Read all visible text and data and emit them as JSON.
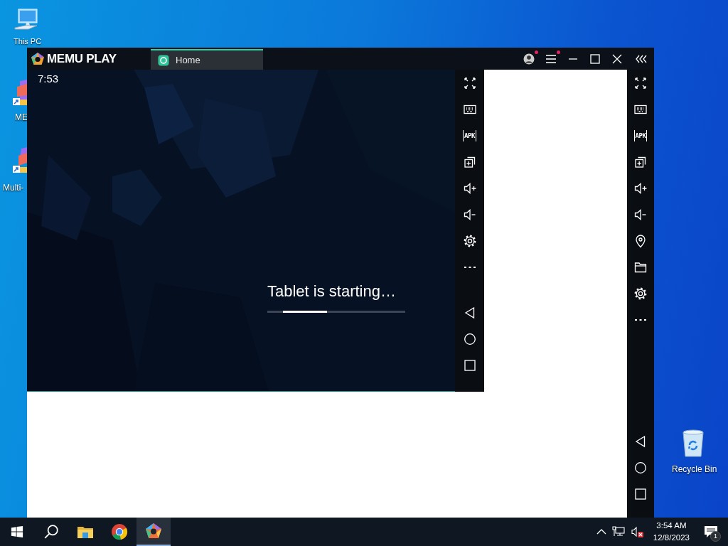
{
  "desktop_icons": [
    {
      "kind": "pc",
      "label": "This PC"
    },
    {
      "kind": "memu",
      "label": "ME"
    },
    {
      "kind": "multi",
      "label": "Multi-"
    },
    {
      "kind": "bin",
      "label": "Recycle Bin"
    }
  ],
  "emulator": {
    "logo": "MEMU PLAY",
    "tabs": [
      {
        "label": "Home",
        "selected": true
      }
    ],
    "title_buttons": [
      {
        "kind": "profile",
        "dot": true
      },
      {
        "kind": "menu",
        "dot": true
      },
      {
        "kind": "minimize",
        "dot": false
      },
      {
        "kind": "maximize",
        "dot": false
      },
      {
        "kind": "close",
        "dot": false
      },
      {
        "kind": "collapse",
        "dot": false
      }
    ],
    "screen": {
      "clock": "7:53",
      "status": "Tablet is starting…",
      "progress": {
        "level": 0.32
      }
    },
    "inner_toolbar": [
      {
        "kind": "fullscreen"
      },
      {
        "kind": "keyboard"
      },
      {
        "kind": "apk",
        "label": "APK"
      },
      {
        "kind": "multi"
      },
      {
        "kind": "volume_up"
      },
      {
        "kind": "volume_down"
      },
      {
        "kind": "settings"
      },
      {
        "kind": "more"
      }
    ],
    "inner_nav": [
      {
        "kind": "back"
      },
      {
        "kind": "home"
      },
      {
        "kind": "recents"
      }
    ],
    "side_toolbar": [
      {
        "kind": "fullscreen"
      },
      {
        "kind": "keyboard"
      },
      {
        "kind": "apk",
        "label": "APK"
      },
      {
        "kind": "multi"
      },
      {
        "kind": "volume_up"
      },
      {
        "kind": "volume_down"
      },
      {
        "kind": "location"
      },
      {
        "kind": "folder"
      },
      {
        "kind": "settings"
      },
      {
        "kind": "more"
      }
    ],
    "side_nav": [
      {
        "kind": "back"
      },
      {
        "kind": "home"
      },
      {
        "kind": "recents"
      }
    ]
  },
  "taskbar": {
    "items": [
      {
        "kind": "start",
        "selected": false
      },
      {
        "kind": "search",
        "selected": false
      },
      {
        "kind": "explorer",
        "selected": false
      },
      {
        "kind": "browser",
        "selected": false
      },
      {
        "kind": "memu",
        "selected": true
      }
    ],
    "tray": {
      "time": "3:54 AM",
      "date": "12/8/2023",
      "notifications": "1"
    }
  }
}
